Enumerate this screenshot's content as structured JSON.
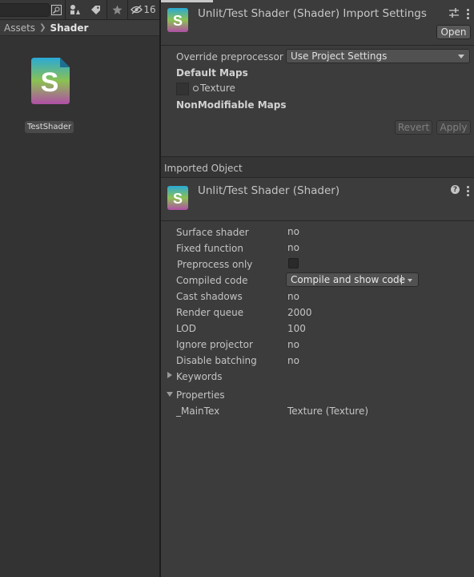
{
  "project": {
    "hidden_count": "16",
    "breadcrumb": {
      "root": "Assets",
      "current": "Shader"
    },
    "asset": {
      "name": "TestShader",
      "icon": "shader-file-icon",
      "icon_letter": "S"
    }
  },
  "import_settings": {
    "title": "Unlit/Test Shader (Shader) Import Settings",
    "open_label": "Open",
    "override_label": "Override preprocessor",
    "override_value": "Use Project Settings",
    "default_maps_label": "Default Maps",
    "texture_label": "Texture",
    "nonmodifiable_label": "NonModifiable Maps",
    "revert_label": "Revert",
    "apply_label": "Apply"
  },
  "imported_object": {
    "section_label": "Imported Object",
    "title": "Unlit/Test Shader (Shader)",
    "props": {
      "surface_shader": {
        "label": "Surface shader",
        "value": "no"
      },
      "fixed_function": {
        "label": "Fixed function",
        "value": "no"
      },
      "preprocess_only": {
        "label": "Preprocess only",
        "checked": false
      },
      "compiled_code": {
        "label": "Compiled code",
        "value": "Compile and show code"
      },
      "cast_shadows": {
        "label": "Cast shadows",
        "value": "no"
      },
      "render_queue": {
        "label": "Render queue",
        "value": "2000"
      },
      "lod": {
        "label": "LOD",
        "value": "100"
      },
      "ignore_projector": {
        "label": "Ignore projector",
        "value": "no"
      },
      "disable_batching": {
        "label": "Disable batching",
        "value": "no"
      }
    },
    "keywords_label": "Keywords",
    "properties_label": "Properties",
    "main_tex": {
      "label": "_MainTex",
      "value": "Texture (Texture)"
    }
  },
  "colors": {
    "shader_icon_top": "#2aa9d6",
    "shader_icon_mid": "#8cc152",
    "shader_icon_bottom": "#b04fa6",
    "panel_bg": "#3c3c3c"
  }
}
